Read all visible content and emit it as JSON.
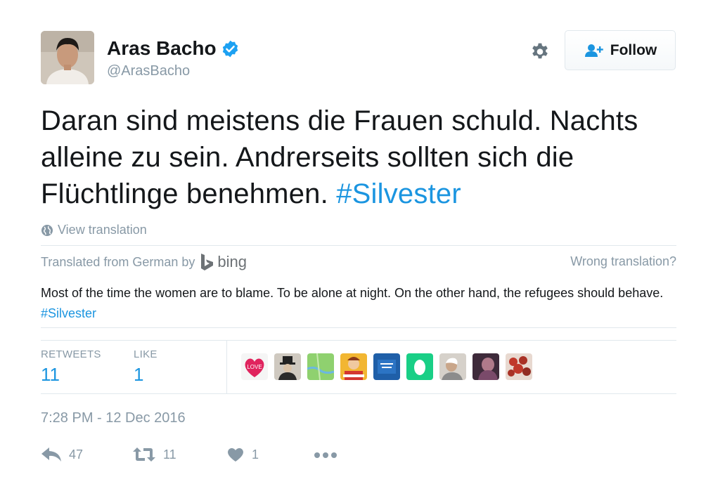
{
  "header": {
    "name": "Aras Bacho",
    "handle": "@ArasBacho",
    "follow_label": "Follow"
  },
  "tweet": {
    "text": "Daran sind meistens die Frauen schuld. Nachts alleine zu sein. Andrerseits sollten sich die Flüchtlinge benehmen. ",
    "hashtag": "#Silvester"
  },
  "translation": {
    "view_label": "View translation",
    "translated_from": "Translated from German by",
    "provider": "bing",
    "wrong_label": "Wrong translation?",
    "text": "Most of the time the women are to blame. To be alone at night. On the other hand, the refugees should behave. ",
    "hashtag": "#Silvester"
  },
  "stats": {
    "retweets_label": "RETWEETS",
    "retweets_value": "11",
    "likes_label": "LIKE",
    "likes_value": "1"
  },
  "likers": [
    {
      "icon": "love-heart-avatar",
      "color": "#e0245e"
    },
    {
      "icon": "top-hat-avatar",
      "color": "#6b5f55"
    },
    {
      "icon": "map-avatar",
      "color": "#8fd16f"
    },
    {
      "icon": "cartoon-avatar",
      "color": "#f2b632"
    },
    {
      "icon": "blue-sign-avatar",
      "color": "#1f5fa8"
    },
    {
      "icon": "egg-avatar",
      "color": "#19cf86"
    },
    {
      "icon": "person-avatar",
      "color": "#b8b0a6"
    },
    {
      "icon": "photo-avatar",
      "color": "#7a4a6a"
    },
    {
      "icon": "flowers-avatar",
      "color": "#c0392b"
    }
  ],
  "timestamp": "7:28 PM - 12 Dec 2016",
  "actions": {
    "reply_count": "47",
    "retweet_count": "11",
    "like_count": "1"
  },
  "colors": {
    "link": "#1b95e0",
    "muted": "#8899a6",
    "text": "#14171a",
    "verified": "#1da1f2"
  }
}
